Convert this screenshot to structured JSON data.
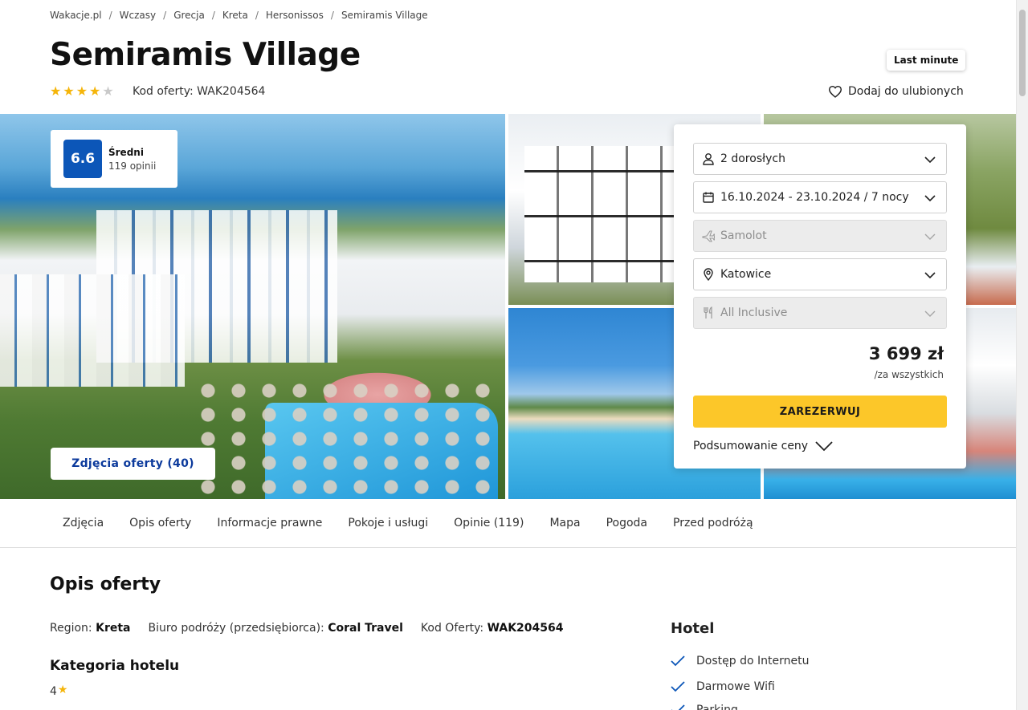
{
  "breadcrumb": [
    "Wakacje.pl",
    "Wczasy",
    "Grecja",
    "Kreta",
    "Hersonissos",
    "Semiramis Village"
  ],
  "hotel": {
    "name": "Semiramis Village",
    "stars": 4,
    "offer_code_text": "Kod oferty: WAK204564"
  },
  "badge": {
    "last_minute": "Last minute"
  },
  "favorites": {
    "label": "Dodaj do ulubionych",
    "icon": "heart-icon"
  },
  "rating": {
    "score": "6.6",
    "label": "Średni",
    "count": "119 opinii"
  },
  "gallery": {
    "photos_button": "Zdjęcia oferty (40)",
    "photo_count": 5
  },
  "booking": {
    "guests": "2 dorosłych",
    "dates": "16.10.2024 - 23.10.2024 / 7 nocy",
    "transport": "Samolot",
    "departure": "Katowice",
    "board": "All Inclusive",
    "price": "3 699 zł",
    "price_note": "/za wszystkich",
    "reserve_button": "ZAREZERWUJ",
    "price_summary": "Podsumowanie ceny"
  },
  "tabs": [
    "Zdjęcia",
    "Opis oferty",
    "Informacje prawne",
    "Pokoje i usługi",
    "Opinie (119)",
    "Mapa",
    "Pogoda",
    "Przed podróżą"
  ],
  "description": {
    "title": "Opis oferty",
    "region_label": "Region:",
    "region_value": "Kreta",
    "agency_label": "Biuro podróży (przedsiębiorca):",
    "agency_value": "Coral Travel",
    "code_label": "Kod Oferty:",
    "code_value": "WAK204564",
    "category_title": "Kategoria hotelu",
    "category_value": "4"
  },
  "amenities": {
    "title": "Hotel",
    "items": [
      "Dostęp do Internetu",
      "Darmowe Wifi",
      "Parking"
    ]
  },
  "colors": {
    "primary_blue": "#0c56b8",
    "link_blue": "#0c3a9c",
    "reserve_yellow": "#fcc729",
    "star_yellow": "#f5b50a"
  }
}
